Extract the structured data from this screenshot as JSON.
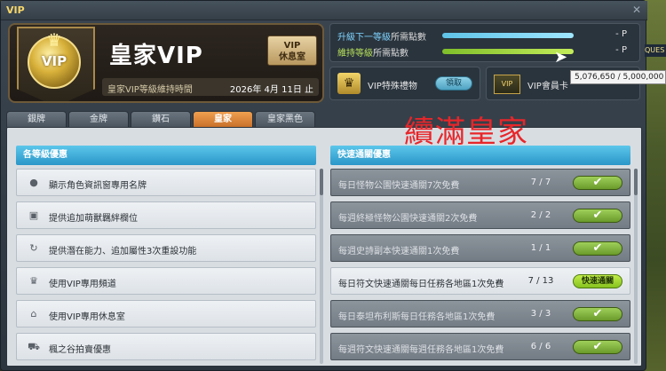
{
  "window": {
    "title": "VIP"
  },
  "banner": {
    "badge_text": "VIP",
    "title": "皇家VIP",
    "lounge_line1": "VIP",
    "lounge_line2": "休息室",
    "maintain_label": "皇家VIP等級維持時間",
    "maintain_date": "2026年 4月 11日 止"
  },
  "points": {
    "next_level_hl": "升級下一等級",
    "next_level_rest": "所需點數",
    "next_level_value": "- P",
    "next_level_progress": 1.0,
    "maintain_hl": "維持等級",
    "maintain_rest": "所需點數",
    "maintain_value": "- P",
    "maintain_progress": 1.0
  },
  "gift": {
    "label": "VIP特殊禮物",
    "claim_label": "領取"
  },
  "card": {
    "icon_text": "VIP",
    "label": "VIP會員卡"
  },
  "tooltip": {
    "text": "5,076,650 / 5,000,000"
  },
  "quest_tag": "QUES",
  "tabs": [
    {
      "label": "銀牌"
    },
    {
      "label": "金牌"
    },
    {
      "label": "鑽石"
    },
    {
      "label": "皇家"
    },
    {
      "label": "皇家黑色"
    }
  ],
  "overlay_text": "續滿皇家",
  "benefits": {
    "header": "各等級優惠",
    "items": [
      {
        "icon": "person-icon",
        "label": "顯示角色資訊窗專用名牌"
      },
      {
        "icon": "slot-icon",
        "label": "提供追加萌獸羈絆欄位"
      },
      {
        "icon": "reroll-icon",
        "label": "提供潛在能力、追加屬性3次重設功能"
      },
      {
        "icon": "crown-icon",
        "label": "使用VIP專用頻道"
      },
      {
        "icon": "lounge-icon",
        "label": "使用VIP專用休息室"
      },
      {
        "icon": "cart-icon",
        "label": "楓之谷拍賣優惠"
      }
    ]
  },
  "quick": {
    "header": "快速通關優惠",
    "items": [
      {
        "label": "每日怪物公園快速通關7次免費",
        "count": "7 / 7",
        "done": true
      },
      {
        "label": "每週終極怪物公園快速通關2次免費",
        "count": "2 / 2",
        "done": true
      },
      {
        "label": "每週史詩副本快速通關1次免費",
        "count": "1 / 1",
        "done": true
      },
      {
        "label": "每日符文快速通關每日任務各地區1次免費",
        "count": "7 / 13",
        "done": false,
        "action": "快速通關"
      },
      {
        "label": "每日泰坦布利斯每日任務各地區1次免費",
        "count": "3 / 3",
        "done": true
      },
      {
        "label": "每週符文快速通關每週任務各地區1次免費",
        "count": "6 / 6",
        "done": true
      }
    ]
  },
  "colors": {
    "accent_tab": "#e0883a",
    "header_blue": "#2a96c8",
    "overlay_red": "#e8262a",
    "check_green": "#7fb23a"
  }
}
